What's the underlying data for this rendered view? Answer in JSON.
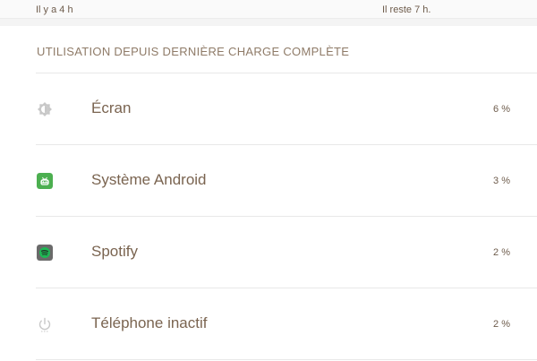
{
  "header_strip": {
    "left_text": "Il y a 4 h",
    "right_text": "Il reste 7 h."
  },
  "section": {
    "title": "UTILISATION DEPUIS DERNIÈRE CHARGE COMPLÈTE"
  },
  "items": [
    {
      "label": "Écran",
      "percent": "6 %",
      "icon": "brightness-icon"
    },
    {
      "label": "Système Android",
      "percent": "3 %",
      "icon": "android-system-icon"
    },
    {
      "label": "Spotify",
      "percent": "2 %",
      "icon": "spotify-icon"
    },
    {
      "label": "Téléphone inactif",
      "percent": "2 %",
      "icon": "power-icon"
    }
  ],
  "colors": {
    "android_green": "#4caf50",
    "spotify_green": "#1db954",
    "text_brown": "#7a6450",
    "icon_grey": "#c8c8c8"
  }
}
